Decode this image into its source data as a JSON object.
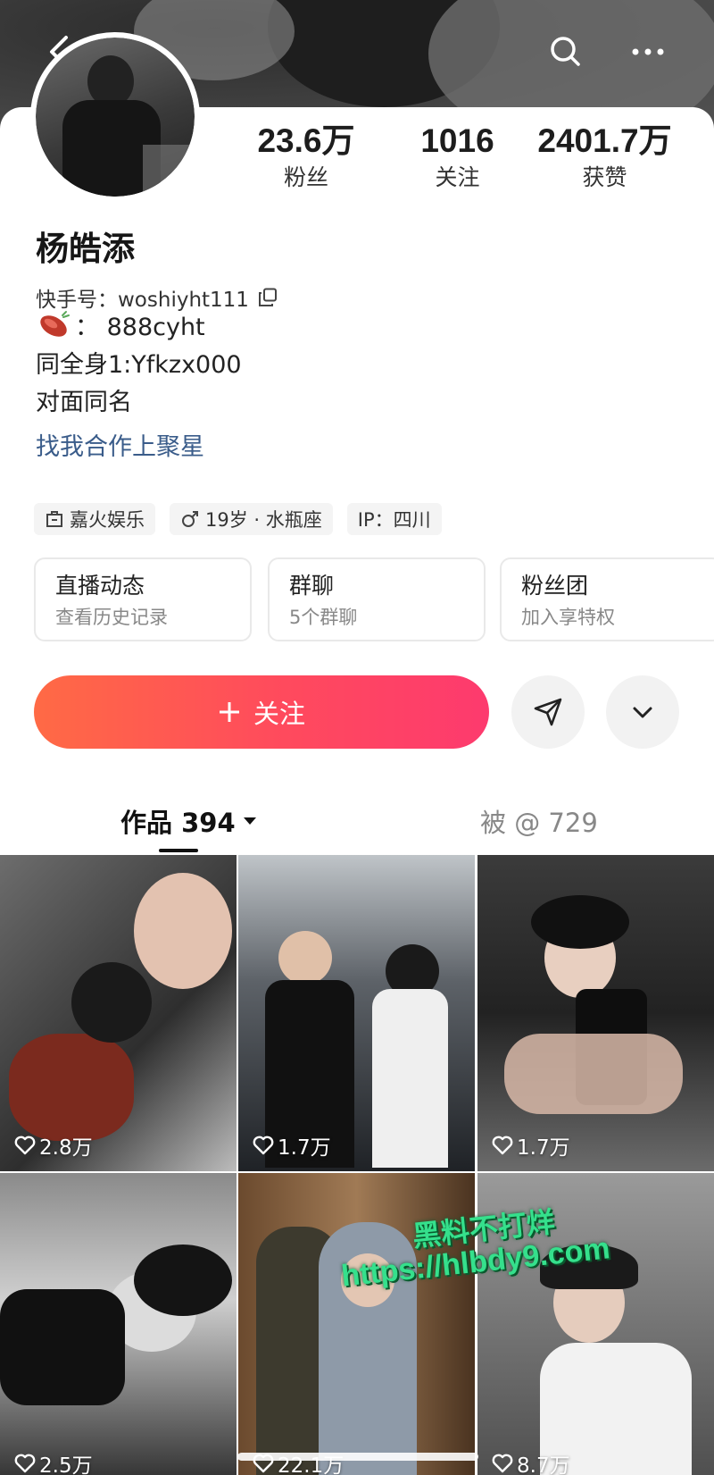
{
  "profile": {
    "name": "杨皓添",
    "kuaishou_id_label": "快手号：",
    "kuaishou_id": "woshiyht111",
    "bio_line1_text": "：  888cyht",
    "bio_line2": "同全身1:Yfkzx000",
    "bio_line3": "对面同名",
    "link": "找我合作上聚星"
  },
  "stats": [
    {
      "value": "23.6万",
      "label": "粉丝"
    },
    {
      "value": "1016",
      "label": "关注"
    },
    {
      "value": "2401.7万",
      "label": "获赞"
    }
  ],
  "tags": [
    "嘉火娱乐",
    "19岁 · 水瓶座",
    "IP：四川"
  ],
  "features": [
    {
      "title": "直播动态",
      "subtitle": "查看历史记录"
    },
    {
      "title": "群聊",
      "subtitle": "5个群聊"
    },
    {
      "title": "粉丝团",
      "subtitle": "加入享特权"
    }
  ],
  "actions": {
    "follow_label": "关注"
  },
  "tabs": {
    "works_label": "作品 394",
    "mentions_label": "被 @ 729"
  },
  "videos": [
    {
      "likes": "2.8万"
    },
    {
      "likes": "1.7万"
    },
    {
      "likes": "1.7万"
    },
    {
      "likes": "2.5万"
    },
    {
      "likes": "22.1万"
    },
    {
      "likes": "8.7万"
    }
  ],
  "watermark": {
    "line1": "黑料不打烊",
    "line2": "https://hlbdy9.com"
  },
  "colors": {
    "follow_start": "#ff6a45",
    "follow_end": "#fd3a6e",
    "link": "#3a5c8a",
    "watermark": "#35e08c"
  }
}
